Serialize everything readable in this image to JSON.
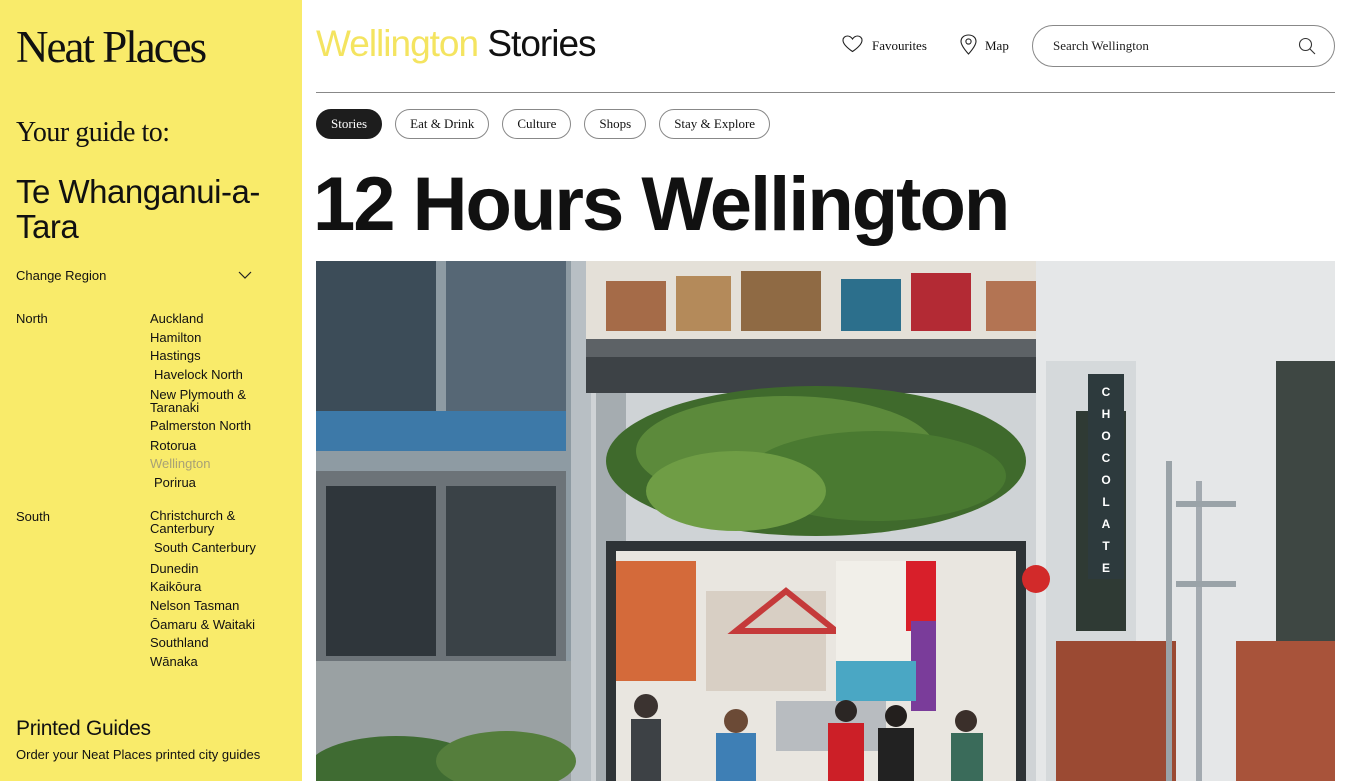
{
  "sidebar": {
    "logo": "Neat Places",
    "guide_to": "Your guide to:",
    "region_name": "Te Whanganui-a-Tara",
    "change_region": "Change Region",
    "north_label": "North",
    "north_cities": [
      "Auckland",
      "Hamilton",
      "Hastings",
      "Havelock North",
      "New Plymouth & Taranaki",
      "Palmerston North",
      "Rotorua",
      "Wellington",
      "Porirua"
    ],
    "south_label": "South",
    "south_cities": [
      "Christchurch & Canterbury",
      "South Canterbury",
      "Dunedin",
      "Kaikōura",
      "Nelson Tasman",
      "Ōamaru & Waitaki",
      "Southland",
      "Wānaka"
    ],
    "active_city": "Wellington",
    "printed_title": "Printed Guides",
    "printed_link": "Order your Neat Places printed city guides"
  },
  "header": {
    "city": "Wellington",
    "section": "Stories",
    "favourites": "Favourites",
    "map": "Map",
    "search_placeholder": "Search Wellington"
  },
  "tabs": [
    "Stories",
    "Eat & Drink",
    "Culture",
    "Shops",
    "Stay & Explore"
  ],
  "active_tab": "Stories",
  "page_heading": "12 Hours Wellington",
  "hero": {
    "sign_text": "CHOCOLATE",
    "alt_icons": [
      "heart-icon",
      "map-pin-icon",
      "search-icon",
      "chevron-down-icon"
    ]
  },
  "colors": {
    "sidebar_bg": "#f9eb6a",
    "city_accent": "#f4e460",
    "active_tab_bg": "#1d1d1d",
    "active_city": "#a8a176"
  }
}
